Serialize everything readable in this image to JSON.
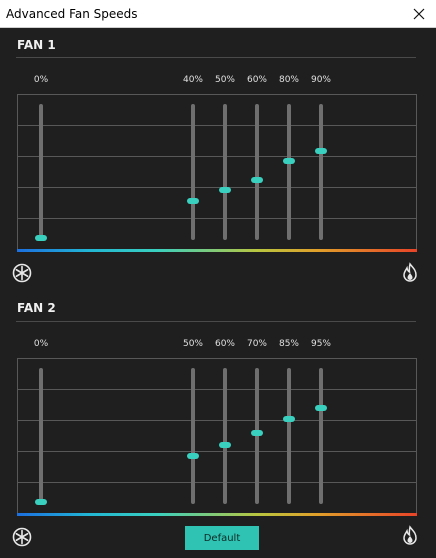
{
  "window": {
    "title": "Advanced Fan Speeds"
  },
  "fans": [
    {
      "name": "FAN 1",
      "points": [
        {
          "label": "0%",
          "level": 0.0
        },
        {
          "label": "40%",
          "level": 0.28
        },
        {
          "label": "50%",
          "level": 0.36
        },
        {
          "label": "60%",
          "level": 0.44
        },
        {
          "label": "80%",
          "level": 0.58
        },
        {
          "label": "90%",
          "level": 0.66
        }
      ]
    },
    {
      "name": "FAN 2",
      "points": [
        {
          "label": "0%",
          "level": 0.0
        },
        {
          "label": "50%",
          "level": 0.35
        },
        {
          "label": "60%",
          "level": 0.43
        },
        {
          "label": "70%",
          "level": 0.52
        },
        {
          "label": "85%",
          "level": 0.63
        },
        {
          "label": "95%",
          "level": 0.71
        }
      ]
    }
  ],
  "footer": {
    "default_label": "Default"
  },
  "icons": {
    "cold": "snowflake-icon",
    "hot": "flame-icon",
    "close": "close-icon"
  },
  "colors": {
    "accent": "#3ad0bf",
    "button": "#2ec3b2",
    "background": "#1f1f1f"
  }
}
